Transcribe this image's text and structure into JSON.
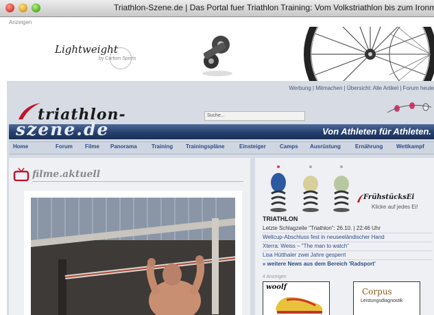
{
  "window": {
    "title": "Triathlon-Szene.de | Das Portal fuer Triathlon Training: Vom Volkstriathlon bis zum Ironman."
  },
  "ad_banner": {
    "label": "Anzeigen",
    "brand": "Lightweight",
    "brand_sub": "by Carbon Sports"
  },
  "topnav": {
    "links_text": "Werbung | Mitmachen | Übersicht: Alle Artikel | Forum heute"
  },
  "header": {
    "logo_line1": "triathlon-",
    "logo_line2": "szene.de",
    "search_placeholder": "Suche...",
    "slogan": "Von Athleten für Athleten."
  },
  "mainnav": {
    "items": [
      "Home",
      "Forum",
      "Filme",
      "Panorama",
      "Training",
      "Trainingspläne",
      "Einsteiger",
      "Camps",
      "Ausrüstung",
      "Ernährung",
      "Wettkampf"
    ]
  },
  "filme": {
    "title": "filme.aktuell"
  },
  "fruehstuecksei": {
    "title": "FrühstücksEi",
    "subtitle": "Klicke auf jedes Ei!"
  },
  "news": {
    "section": "TRIATHLON",
    "items": [
      "Letzte Schlagzeile \"Triathlon\": 26.10. | 22:46 Uhr",
      "Weltcup-Abschluss fest in neuseeländischer Hand",
      "Xterra: Weiss – \"The man to watch\"",
      "Lisa Hütthaler zwei Jahre gesperrt"
    ],
    "more": "» weitere News aus dem Bereich 'Radsport'"
  },
  "ads": {
    "count_label": "4 Anzeigen",
    "ad1_brand": "woolf",
    "ad2_brand": "Corpus",
    "ad2_sub": "Leistungsdiagnostik"
  }
}
